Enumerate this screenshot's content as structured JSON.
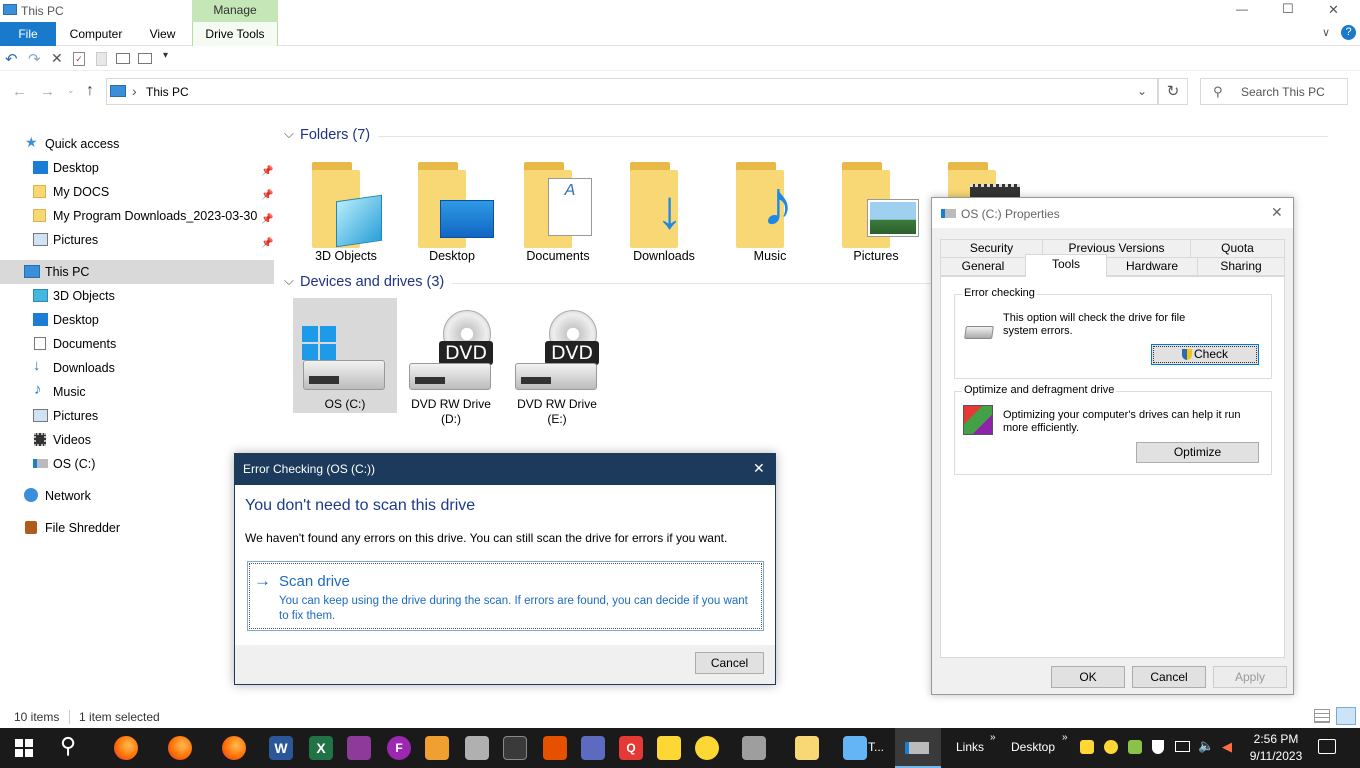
{
  "window": {
    "title": "This PC",
    "minimize": "—",
    "maximize": "☐",
    "close": "✕"
  },
  "ribbon": {
    "file": "File",
    "tabs": [
      "Computer",
      "View"
    ],
    "manage_header": "Manage",
    "manage_tab": "Drive Tools"
  },
  "address": {
    "path": "This PC",
    "separator": "›"
  },
  "search": {
    "placeholder": "Search This PC"
  },
  "nav": {
    "quick_access": "Quick access",
    "quick_items": [
      "Desktop",
      "My DOCS",
      "My Program Downloads_2023-03-30",
      "Pictures"
    ],
    "this_pc": "This PC",
    "pc_items": [
      "3D Objects",
      "Desktop",
      "Documents",
      "Downloads",
      "Music",
      "Pictures",
      "Videos",
      "OS (C:)"
    ],
    "network": "Network",
    "file_shredder": "File Shredder"
  },
  "folders": {
    "header": "Folders (7)",
    "items": [
      "3D Objects",
      "Desktop",
      "Documents",
      "Downloads",
      "Music",
      "Pictures"
    ]
  },
  "drives": {
    "header": "Devices and drives (3)",
    "items": [
      {
        "name": "OS (C:)"
      },
      {
        "name": "DVD RW Drive",
        "sub": "(D:)",
        "badge": "DVD"
      },
      {
        "name": "DVD RW Drive",
        "sub": "(E:)",
        "badge": "DVD"
      }
    ]
  },
  "status": {
    "items": "10 items",
    "selected": "1 item selected"
  },
  "props": {
    "title": "OS (C:) Properties",
    "tabs_row1": [
      "Security",
      "Previous Versions",
      "Quota"
    ],
    "tabs_row2": [
      "General",
      "Tools",
      "Hardware",
      "Sharing"
    ],
    "error_group": "Error checking",
    "error_text": "This option will check the drive for file system errors.",
    "check_btn": "Check",
    "optimize_group": "Optimize and defragment drive",
    "optimize_text": "Optimizing your computer's drives can help it run more efficiently.",
    "optimize_btn": "Optimize",
    "ok": "OK",
    "cancel": "Cancel",
    "apply": "Apply"
  },
  "errdlg": {
    "title": "Error Checking (OS (C:))",
    "heading": "You don't need to scan this drive",
    "body": "We haven't found any errors on this drive. You can still scan the drive for errors if you want.",
    "scan_title": "Scan drive",
    "scan_desc": "You can keep using the drive during the scan. If errors are found, you can decide if you want to fix them.",
    "cancel": "Cancel"
  },
  "taskbar": {
    "task_label": "T...",
    "links": "Links",
    "desktop": "Desktop",
    "time": "2:56 PM",
    "date": "9/11/2023"
  }
}
